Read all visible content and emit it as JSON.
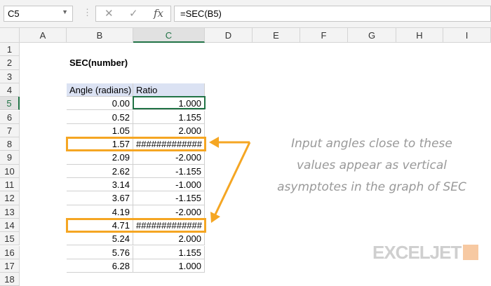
{
  "formula_bar": {
    "name_box": "C5",
    "cancel": "✕",
    "enter": "✓",
    "fx": "fx",
    "formula": "=SEC(B5)"
  },
  "columns": [
    "A",
    "B",
    "C",
    "D",
    "E",
    "F",
    "G",
    "H",
    "I"
  ],
  "rows": [
    "1",
    "2",
    "3",
    "4",
    "5",
    "6",
    "7",
    "8",
    "9",
    "10",
    "11",
    "12",
    "13",
    "14",
    "15",
    "16",
    "17",
    "18"
  ],
  "title": "SEC(number)",
  "table": {
    "headers": [
      "Angle (radians)",
      "Ratio"
    ],
    "rows": [
      [
        "0.00",
        "1.000"
      ],
      [
        "0.52",
        "1.155"
      ],
      [
        "1.05",
        "2.000"
      ],
      [
        "1.57",
        "#############"
      ],
      [
        "2.09",
        "-2.000"
      ],
      [
        "2.62",
        "-1.155"
      ],
      [
        "3.14",
        "-1.000"
      ],
      [
        "3.67",
        "-1.155"
      ],
      [
        "4.19",
        "-2.000"
      ],
      [
        "4.71",
        "#############"
      ],
      [
        "5.24",
        "2.000"
      ],
      [
        "5.76",
        "1.155"
      ],
      [
        "6.28",
        "1.000"
      ]
    ]
  },
  "note": "Input angles close to these values appear as vertical asymptotes in the graph of SEC",
  "logo": "EXCELJET",
  "colors": {
    "highlight": "#f5a623",
    "selection": "#217346",
    "header_fill": "#dbe2f3"
  }
}
